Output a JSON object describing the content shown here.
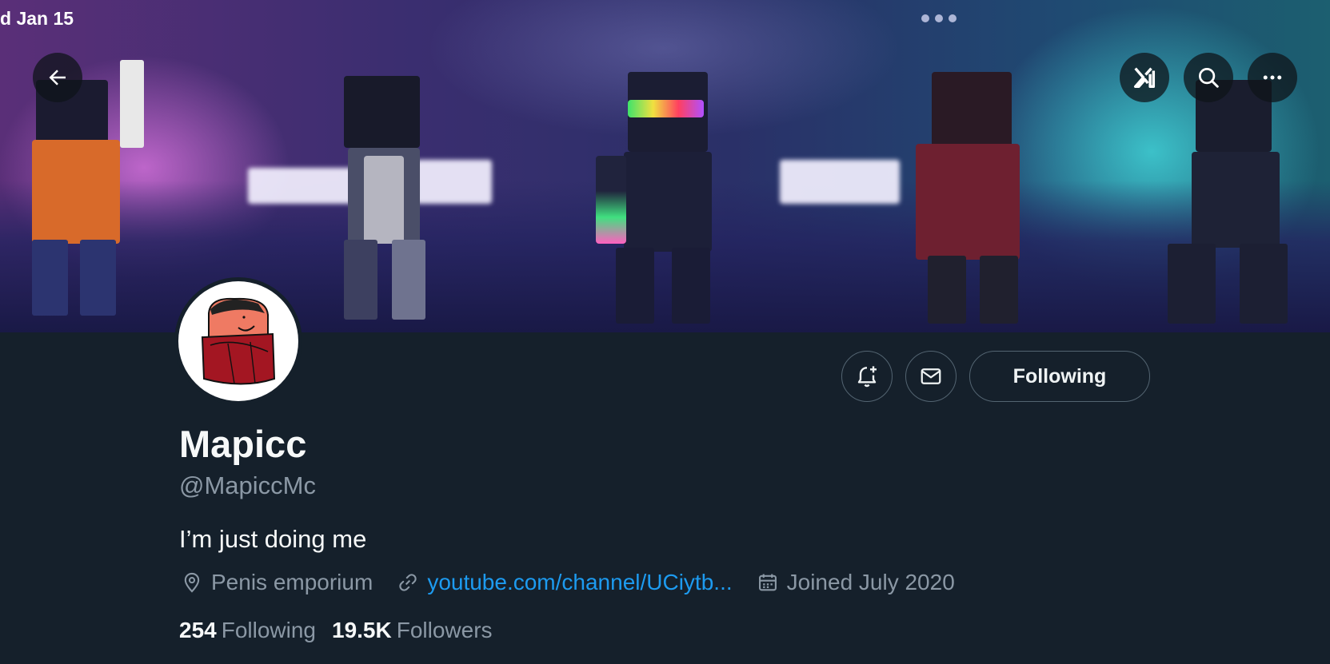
{
  "status_bar": {
    "time_fragment": "d Jan 15"
  },
  "header": {
    "back_icon": "arrow-left-icon",
    "grok_icon": "grok-icon",
    "search_icon": "search-icon",
    "more_icon": "more-horizontal-icon"
  },
  "profile": {
    "display_name": "Mapicc",
    "handle": "@MapiccMc",
    "bio": "I’m just doing me",
    "location": "Penis emporium",
    "website": "youtube.com/channel/UCiytb...",
    "joined": "Joined July 2020",
    "following_count": "254",
    "following_label": "Following",
    "followers_count": "19.5K",
    "followers_label": "Followers"
  },
  "actions": {
    "notify_icon": "bell-plus-icon",
    "message_icon": "envelope-icon",
    "follow_button_label": "Following"
  },
  "colors": {
    "background": "#15202b",
    "link": "#1d9bf0",
    "secondary_text": "#8b98a5",
    "primary_text": "#f7f9f9"
  }
}
